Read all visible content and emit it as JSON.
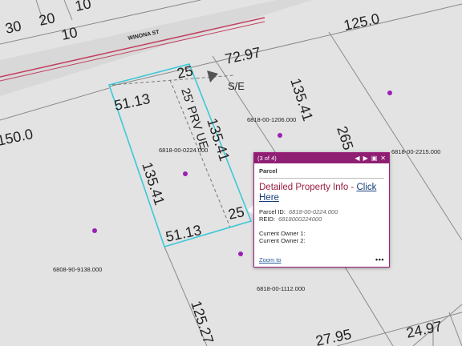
{
  "map": {
    "street_name": "WINONA ST",
    "dimension_labels": [
      "30",
      "20",
      "10",
      "10",
      "125.0",
      "72.97",
      "25",
      "S/E",
      "135.41",
      "51.13",
      "25' PRV UE",
      "135.41",
      "135.41",
      "265",
      "150.0",
      "25",
      "51.13",
      "125.27",
      "27.95",
      "24.97"
    ],
    "parcel_labels": [
      "6818-00-1206.000",
      "6818-00-0224.000",
      "6818-00-2215.000",
      "6808-90-9138.000",
      "6818-00-1112.000"
    ],
    "colors": {
      "selection": "#3cc8d8",
      "parcel_point": "#9b1fb5",
      "road_line": "#c44060",
      "popup_accent": "#8e1f73"
    }
  },
  "popup": {
    "counter": "(3 of 4)",
    "layer_title": "Parcel",
    "heading_text": "Detailed Property Info - ",
    "heading_link": "Click Here",
    "parcel_id_label": "Parcel ID:",
    "parcel_id_value": "6818-00-0224.000",
    "reid_label": "REID:",
    "reid_value": "6818000224000",
    "owner1_label": "Current Owner 1:",
    "owner2_label": "Current Owner 2:",
    "zoom_label": "Zoom to",
    "more_label": "•••",
    "icons": [
      "prev-icon",
      "next-icon",
      "maximize-icon",
      "close-icon"
    ]
  }
}
